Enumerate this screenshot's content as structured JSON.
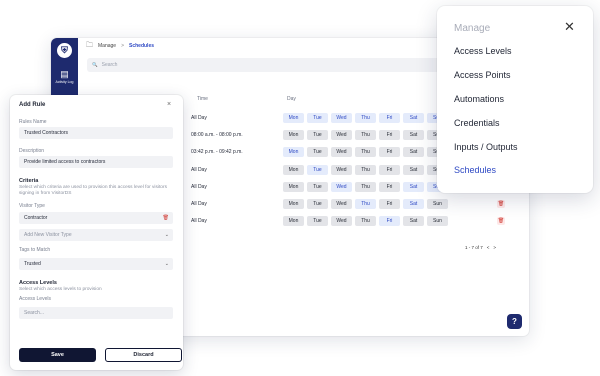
{
  "app": {
    "sidebar": {
      "logo": "⛨",
      "activity_icon": "▤",
      "activity_label": "Activity Log"
    },
    "breadcrumb": {
      "folder_icon": "🗀",
      "home": "Manage",
      "sep": ">",
      "current": "Schedules"
    },
    "search": {
      "icon": "🔍",
      "placeholder": "Search"
    },
    "columns": {
      "time": "Time",
      "day": "Day"
    },
    "rows": [
      {
        "time": "All Day",
        "days": [
          {
            "l": "Mon",
            "on": true
          },
          {
            "l": "Tue",
            "on": true
          },
          {
            "l": "Wed",
            "on": true
          },
          {
            "l": "Thu",
            "on": true
          },
          {
            "l": "Fri",
            "on": true
          },
          {
            "l": "Sat",
            "on": true
          },
          {
            "l": "Sun",
            "on": true
          }
        ]
      },
      {
        "time": "08:00 a.m. - 08:00 p.m.",
        "days": [
          {
            "l": "Mon",
            "on": false
          },
          {
            "l": "Tue",
            "on": false
          },
          {
            "l": "Wed",
            "on": false
          },
          {
            "l": "Thu",
            "on": false
          },
          {
            "l": "Fri",
            "on": false
          },
          {
            "l": "Sat",
            "on": false
          },
          {
            "l": "Sun",
            "on": false
          }
        ]
      },
      {
        "time": "03:42 p.m. - 09:42 p.m.",
        "days": [
          {
            "l": "Mon",
            "on": true
          },
          {
            "l": "Tue",
            "on": false
          },
          {
            "l": "Wed",
            "on": false
          },
          {
            "l": "Thu",
            "on": false
          },
          {
            "l": "Fri",
            "on": false
          },
          {
            "l": "Sat",
            "on": false
          },
          {
            "l": "Sun",
            "on": false
          }
        ]
      },
      {
        "time": "All Day",
        "days": [
          {
            "l": "Mon",
            "on": false
          },
          {
            "l": "Tue",
            "on": true
          },
          {
            "l": "Wed",
            "on": false
          },
          {
            "l": "Thu",
            "on": false
          },
          {
            "l": "Fri",
            "on": false
          },
          {
            "l": "Sat",
            "on": false
          },
          {
            "l": "Sun",
            "on": false
          }
        ]
      },
      {
        "time": "All Day",
        "days": [
          {
            "l": "Mon",
            "on": false
          },
          {
            "l": "Tue",
            "on": false
          },
          {
            "l": "Wed",
            "on": true
          },
          {
            "l": "Thu",
            "on": false
          },
          {
            "l": "Fri",
            "on": false
          },
          {
            "l": "Sat",
            "on": true
          },
          {
            "l": "Sun",
            "on": true
          }
        ]
      },
      {
        "time": "All Day",
        "days": [
          {
            "l": "Mon",
            "on": false
          },
          {
            "l": "Tue",
            "on": false
          },
          {
            "l": "Wed",
            "on": false
          },
          {
            "l": "Thu",
            "on": true
          },
          {
            "l": "Fri",
            "on": false
          },
          {
            "l": "Sat",
            "on": true
          },
          {
            "l": "Sun",
            "on": false
          }
        ]
      },
      {
        "time": "All Day",
        "days": [
          {
            "l": "Mon",
            "on": false
          },
          {
            "l": "Tue",
            "on": false
          },
          {
            "l": "Wed",
            "on": false
          },
          {
            "l": "Thu",
            "on": false
          },
          {
            "l": "Fri",
            "on": true
          },
          {
            "l": "Sat",
            "on": false
          },
          {
            "l": "Sun",
            "on": false
          }
        ]
      }
    ],
    "trash_icon": "🗑",
    "pagination": {
      "text": "1 - 7 of 7",
      "prev": "<",
      "next": ">"
    },
    "help": "?"
  },
  "add_rule": {
    "title": "Add Rule",
    "close": "×",
    "rules_name_label": "Rules Name",
    "rules_name_value": "Trusted Contractors",
    "description_label": "Description",
    "description_value": "Provide limited access to contractors",
    "criteria_title": "Criteria",
    "criteria_sub": "Select which criteria are used to provision this access level for visitors signing in from VisitorDS",
    "visitor_type_label": "Visitor Type",
    "visitor_type_value": "Contractor",
    "add_visitor_type_placeholder": "Add New Visitor Type",
    "tags_label": "Tags to Match",
    "tags_value": "Trusted",
    "access_title": "Access Levels",
    "access_sub": "Select which access levels to provision",
    "access_levels_label": "Access Levels",
    "access_search_placeholder": "Search...",
    "save": "Save",
    "discard": "Discard",
    "delete_icon": "🗑",
    "chevron": "⌄"
  },
  "menu": {
    "title": "Manage",
    "close": "✕",
    "items": [
      "Access Levels",
      "Access Points",
      "Automations",
      "Credentials",
      "Inputs / Outputs",
      "Schedules"
    ],
    "active_index": 5
  },
  "colors": {
    "accent": "#2e49c4",
    "sidebar": "#1e2a6e",
    "danger": "#d0342c"
  }
}
